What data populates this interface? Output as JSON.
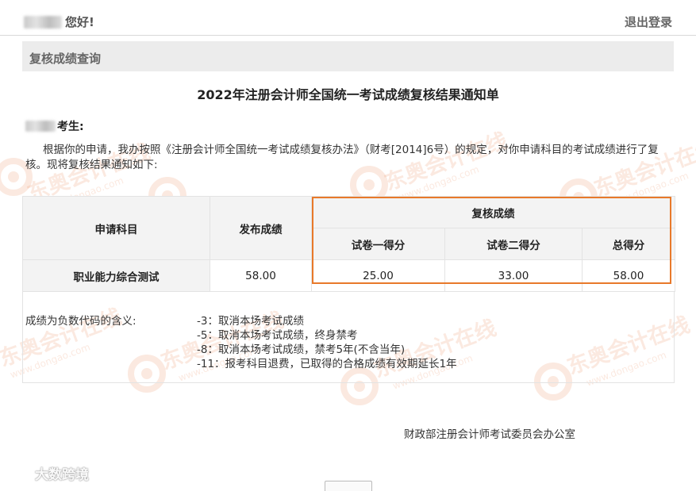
{
  "header": {
    "greeting": "您好!",
    "logout": "退出登录"
  },
  "section": {
    "title": "复核成绩查询"
  },
  "notice": {
    "title": "2022年注册会计师全国统一考试成绩复核结果通知单",
    "salutation_suffix": "考生:",
    "paragraph": "根据你的申请，我办按照《注册会计师全国统一考试成绩复核办法》（财考[2014]6号）的规定，对你申请科目的考试成绩进行了复核。现将复核结果通知如下:"
  },
  "table": {
    "col_subject": "申请科目",
    "col_published": "发布成绩",
    "col_review": "复核成绩",
    "col_paper1": "试卷一得分",
    "col_paper2": "试卷二得分",
    "col_total": "总得分",
    "rows": [
      {
        "subject": "职业能力综合测试",
        "published": "58.00",
        "paper1": "25.00",
        "paper2": "33.00",
        "total": "58.00"
      }
    ]
  },
  "codes": {
    "label": "成绩为负数代码的含义:",
    "items": [
      "-3：取消本场考试成绩",
      "-5：取消本场考试成绩，终身禁考",
      "-8：取消本场考试成绩，禁考5年(不含当年)",
      "-11：报考科目退费，已取得的合格成绩有效期延长1年"
    ]
  },
  "signature": "财政部注册会计师考试委员会办公室",
  "watermark": {
    "text": "东奥会计在线",
    "url": "www.dongao.com",
    "color": "#e8783c"
  },
  "corner_watermark": "大数跨境",
  "colors": {
    "highlight": "#e8792a",
    "header_bg": "#f3f3f3",
    "section_bg": "#ececec"
  }
}
